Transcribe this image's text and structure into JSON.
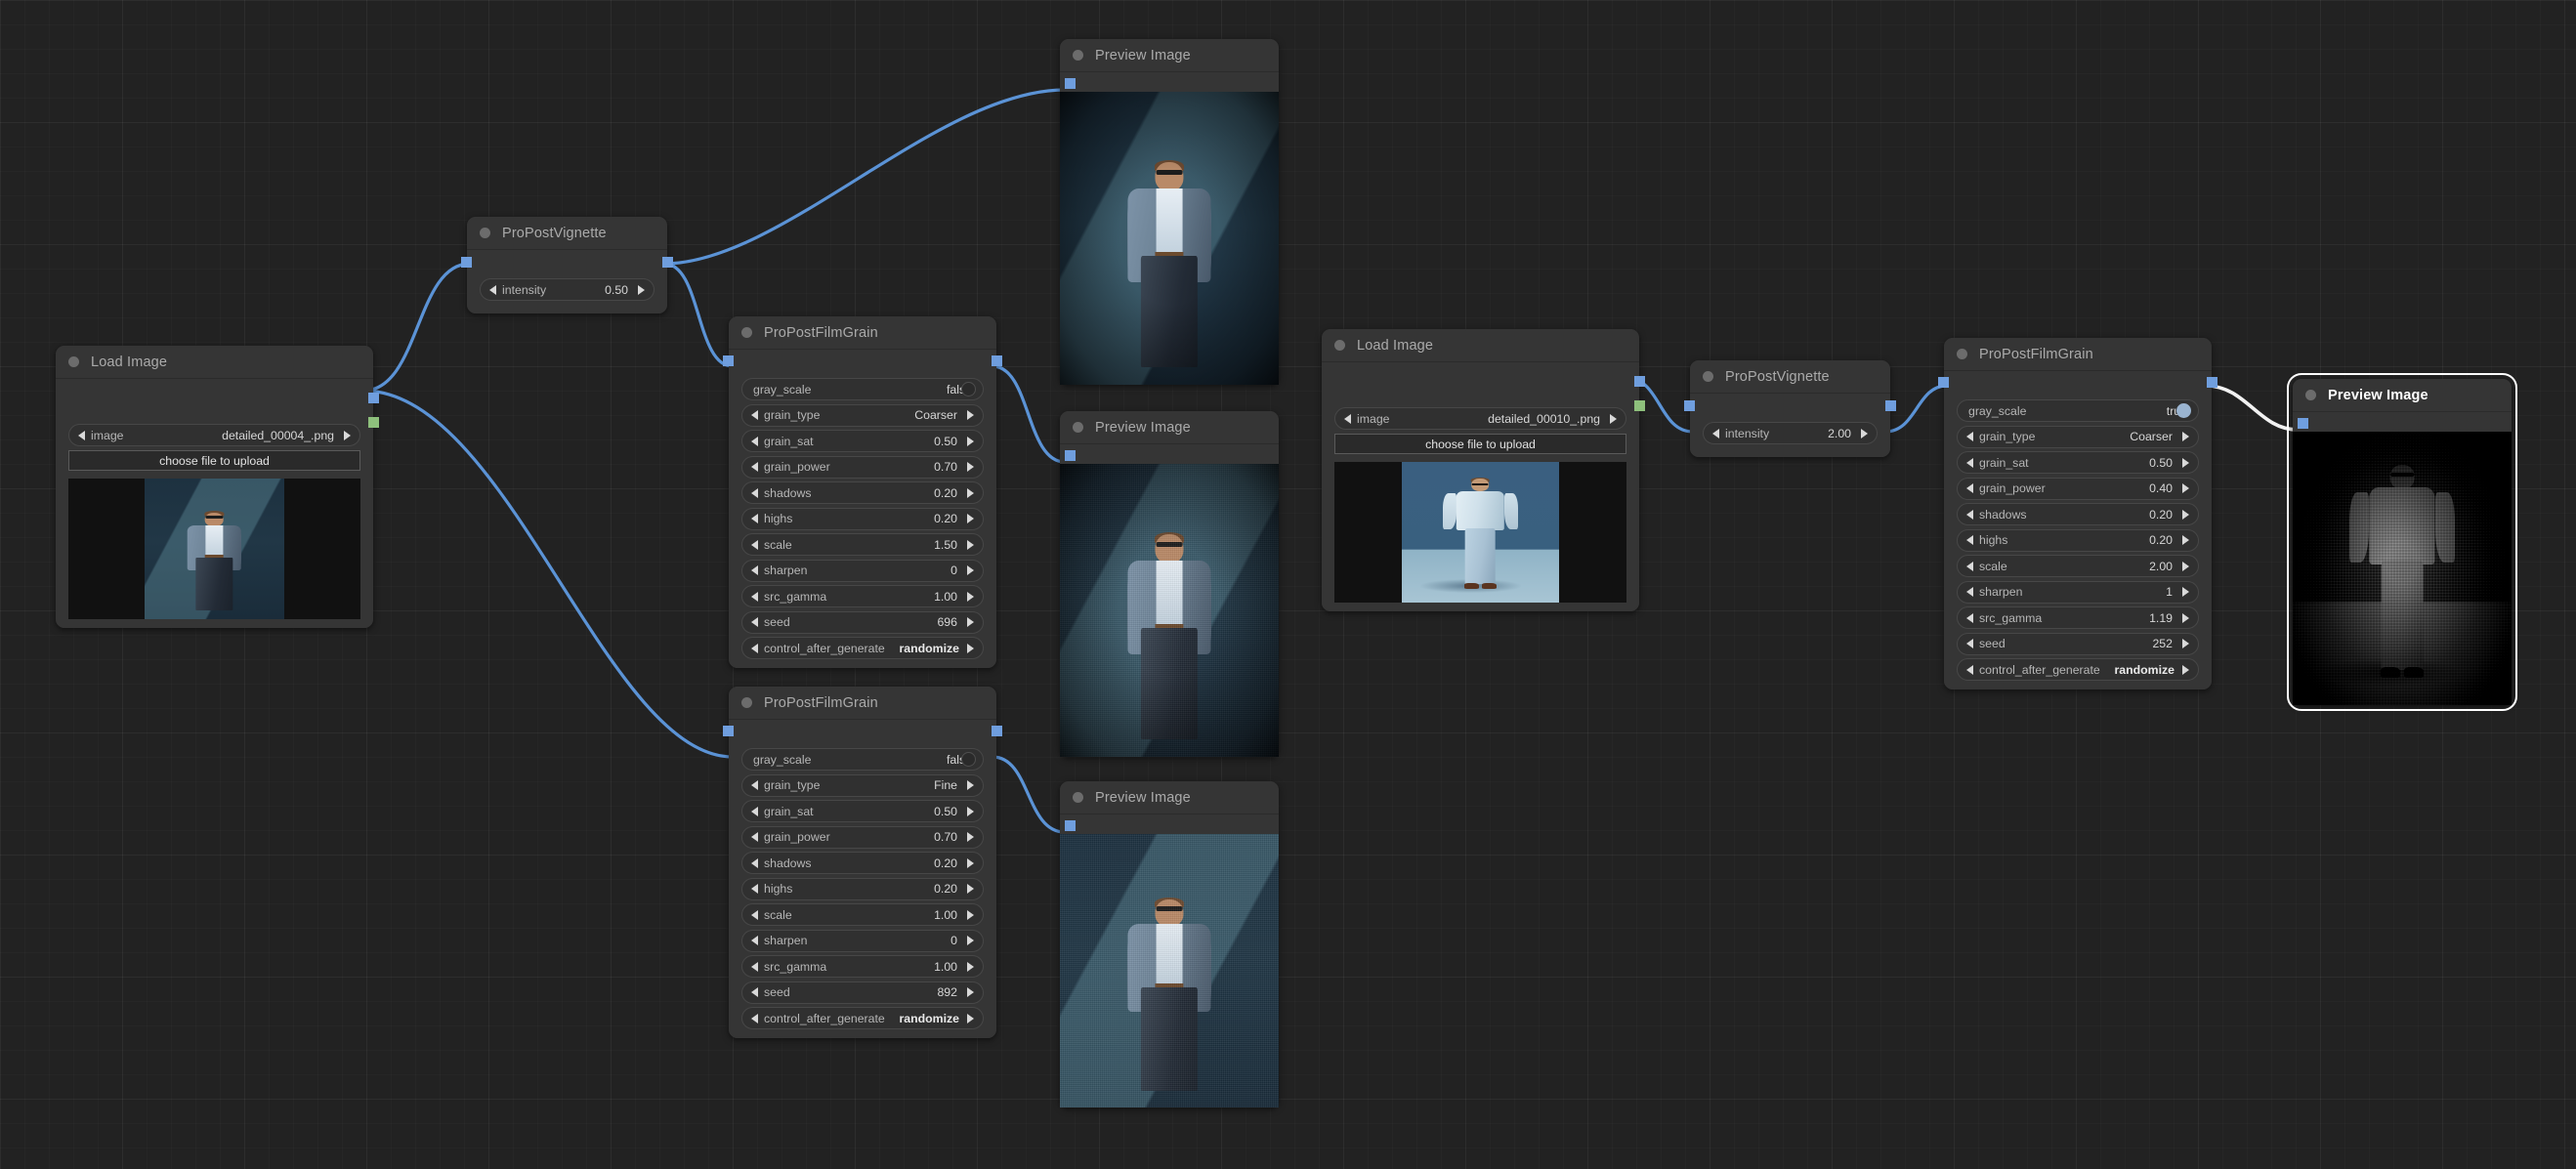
{
  "app": {
    "canvas_background": "#222222",
    "link_color": "#6f9ede",
    "link_color_selected": "#ffffff"
  },
  "nodes": {
    "load_image_1": {
      "title": "Load Image",
      "widgets": [
        {
          "name": "image",
          "label": "image",
          "value": "detailed_00004_.png",
          "type": "combo"
        }
      ],
      "upload_label": "choose file to upload"
    },
    "vignette_1": {
      "title": "ProPostVignette",
      "widgets": [
        {
          "name": "intensity",
          "label": "intensity",
          "value": "0.50",
          "type": "number"
        }
      ]
    },
    "filmgrain_1": {
      "title": "ProPostFilmGrain",
      "widgets": [
        {
          "name": "gray_scale",
          "label": "gray_scale",
          "value": "false",
          "type": "toggle"
        },
        {
          "name": "grain_type",
          "label": "grain_type",
          "value": "Coarser",
          "type": "combo"
        },
        {
          "name": "grain_sat",
          "label": "grain_sat",
          "value": "0.50",
          "type": "number"
        },
        {
          "name": "grain_power",
          "label": "grain_power",
          "value": "0.70",
          "type": "number"
        },
        {
          "name": "shadows",
          "label": "shadows",
          "value": "0.20",
          "type": "number"
        },
        {
          "name": "highs",
          "label": "highs",
          "value": "0.20",
          "type": "number"
        },
        {
          "name": "scale",
          "label": "scale",
          "value": "1.50",
          "type": "number"
        },
        {
          "name": "sharpen",
          "label": "sharpen",
          "value": "0",
          "type": "number"
        },
        {
          "name": "src_gamma",
          "label": "src_gamma",
          "value": "1.00",
          "type": "number"
        },
        {
          "name": "seed",
          "label": "seed",
          "value": "696",
          "type": "number"
        },
        {
          "name": "control_after_generate",
          "label": "control_after_generate",
          "value": "randomize",
          "type": "combo"
        }
      ]
    },
    "filmgrain_2": {
      "title": "ProPostFilmGrain",
      "widgets": [
        {
          "name": "gray_scale",
          "label": "gray_scale",
          "value": "false",
          "type": "toggle"
        },
        {
          "name": "grain_type",
          "label": "grain_type",
          "value": "Fine",
          "type": "combo"
        },
        {
          "name": "grain_sat",
          "label": "grain_sat",
          "value": "0.50",
          "type": "number"
        },
        {
          "name": "grain_power",
          "label": "grain_power",
          "value": "0.70",
          "type": "number"
        },
        {
          "name": "shadows",
          "label": "shadows",
          "value": "0.20",
          "type": "number"
        },
        {
          "name": "highs",
          "label": "highs",
          "value": "0.20",
          "type": "number"
        },
        {
          "name": "scale",
          "label": "scale",
          "value": "1.00",
          "type": "number"
        },
        {
          "name": "sharpen",
          "label": "sharpen",
          "value": "0",
          "type": "number"
        },
        {
          "name": "src_gamma",
          "label": "src_gamma",
          "value": "1.00",
          "type": "number"
        },
        {
          "name": "seed",
          "label": "seed",
          "value": "892",
          "type": "number"
        },
        {
          "name": "control_after_generate",
          "label": "control_after_generate",
          "value": "randomize",
          "type": "combo"
        }
      ]
    },
    "load_image_2": {
      "title": "Load Image",
      "widgets": [
        {
          "name": "image",
          "label": "image",
          "value": "detailed_00010_.png",
          "type": "combo"
        }
      ],
      "upload_label": "choose file to upload"
    },
    "vignette_2": {
      "title": "ProPostVignette",
      "widgets": [
        {
          "name": "intensity",
          "label": "intensity",
          "value": "2.00",
          "type": "number"
        }
      ]
    },
    "filmgrain_3": {
      "title": "ProPostFilmGrain",
      "widgets": [
        {
          "name": "gray_scale",
          "label": "gray_scale",
          "value": "true",
          "type": "toggle"
        },
        {
          "name": "grain_type",
          "label": "grain_type",
          "value": "Coarser",
          "type": "combo"
        },
        {
          "name": "grain_sat",
          "label": "grain_sat",
          "value": "0.50",
          "type": "number"
        },
        {
          "name": "grain_power",
          "label": "grain_power",
          "value": "0.40",
          "type": "number"
        },
        {
          "name": "shadows",
          "label": "shadows",
          "value": "0.20",
          "type": "number"
        },
        {
          "name": "highs",
          "label": "highs",
          "value": "0.20",
          "type": "number"
        },
        {
          "name": "scale",
          "label": "scale",
          "value": "2.00",
          "type": "number"
        },
        {
          "name": "sharpen",
          "label": "sharpen",
          "value": "1",
          "type": "number"
        },
        {
          "name": "src_gamma",
          "label": "src_gamma",
          "value": "1.19",
          "type": "number"
        },
        {
          "name": "seed",
          "label": "seed",
          "value": "252",
          "type": "number"
        },
        {
          "name": "control_after_generate",
          "label": "control_after_generate",
          "value": "randomize",
          "type": "combo"
        }
      ]
    },
    "preview_1": {
      "title": "Preview Image"
    },
    "preview_2": {
      "title": "Preview Image"
    },
    "preview_3": {
      "title": "Preview Image"
    },
    "preview_4": {
      "title": "Preview Image",
      "selected": true
    }
  }
}
